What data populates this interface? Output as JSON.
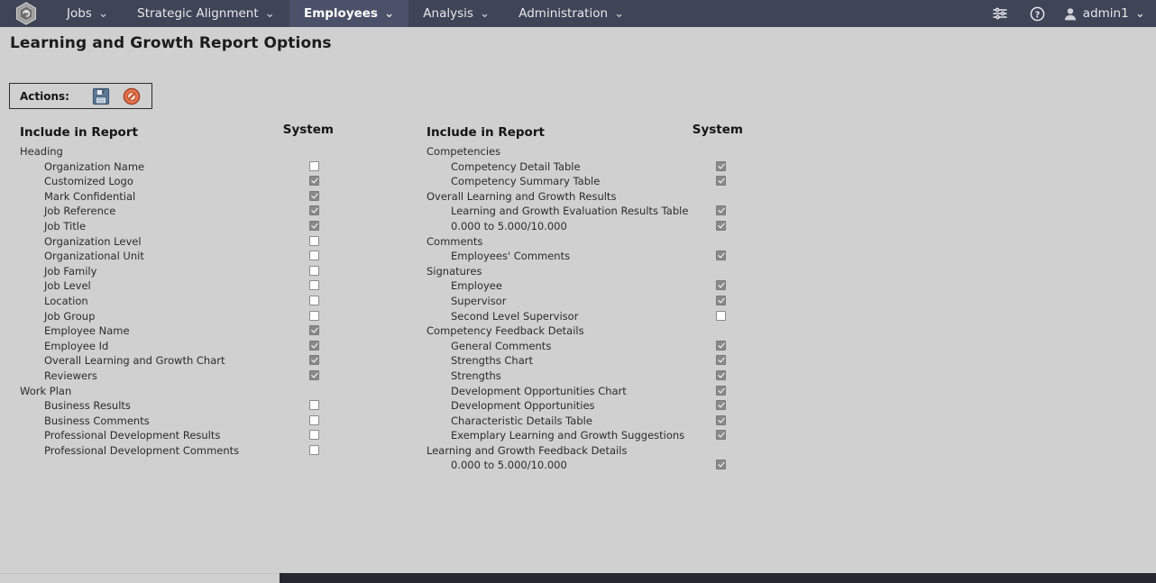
{
  "header": {
    "logo_icon": "hexagon-cube-logo",
    "nav_items": [
      {
        "label": "Jobs",
        "active": false,
        "caret": "⌄"
      },
      {
        "label": "Strategic Alignment",
        "active": false,
        "caret": "⌄"
      },
      {
        "label": "Employees",
        "active": true,
        "caret": "⌄"
      },
      {
        "label": "Analysis",
        "active": false,
        "caret": "⌄"
      },
      {
        "label": "Administration",
        "active": false,
        "caret": "⌄"
      }
    ],
    "right_icons": [
      {
        "name": "sliders-settings-icon"
      },
      {
        "name": "help-question-icon"
      }
    ],
    "user": {
      "name": "admin1",
      "icon": "user-avatar-icon",
      "caret": "⌄"
    },
    "bar_color": "#3f4456",
    "active_tab_color": "#4b5168"
  },
  "page": {
    "title": "Learning and Growth Report Options",
    "background": "#d0d0d0"
  },
  "toolbar": {
    "label": "Actions:",
    "buttons": [
      {
        "name": "save-button",
        "icon": "floppy-disk-save-icon",
        "title": "Save"
      },
      {
        "name": "cancel-button",
        "icon": "prohibited-cancel-icon",
        "title": "Cancel"
      }
    ]
  },
  "columns": [
    {
      "id": "left",
      "header_include": "Include in Report",
      "header_system": "System",
      "rows": [
        {
          "label": "Heading",
          "type": "group"
        },
        {
          "label": "Organization Name",
          "type": "item",
          "checked": false
        },
        {
          "label": "Customized Logo",
          "type": "item",
          "checked": true
        },
        {
          "label": "Mark Confidential",
          "type": "item",
          "checked": true
        },
        {
          "label": "Job Reference",
          "type": "item",
          "checked": true
        },
        {
          "label": "Job Title",
          "type": "item",
          "checked": true
        },
        {
          "label": "Organization Level",
          "type": "item",
          "checked": false
        },
        {
          "label": "Organizational Unit",
          "type": "item",
          "checked": false
        },
        {
          "label": "Job Family",
          "type": "item",
          "checked": false
        },
        {
          "label": "Job Level",
          "type": "item",
          "checked": false
        },
        {
          "label": "Location",
          "type": "item",
          "checked": false
        },
        {
          "label": "Job Group",
          "type": "item",
          "checked": false
        },
        {
          "label": "Employee Name",
          "type": "item",
          "checked": true
        },
        {
          "label": "Employee Id",
          "type": "item",
          "checked": true
        },
        {
          "label": "Overall Learning and Growth Chart",
          "type": "item",
          "checked": true
        },
        {
          "label": "Reviewers",
          "type": "item",
          "checked": true
        },
        {
          "label": "Work Plan",
          "type": "group"
        },
        {
          "label": "Business Results",
          "type": "item",
          "checked": false
        },
        {
          "label": "Business Comments",
          "type": "item",
          "checked": false
        },
        {
          "label": "Professional Development Results",
          "type": "item",
          "checked": false
        },
        {
          "label": "Professional Development Comments",
          "type": "item",
          "checked": false
        }
      ]
    },
    {
      "id": "right",
      "header_include": "Include in Report",
      "header_system": "System",
      "rows": [
        {
          "label": "Competencies",
          "type": "group"
        },
        {
          "label": "Competency Detail Table",
          "type": "item",
          "checked": true
        },
        {
          "label": "Competency Summary Table",
          "type": "item",
          "checked": true
        },
        {
          "label": "Overall Learning and Growth Results",
          "type": "group"
        },
        {
          "label": "Learning and Growth Evaluation Results Table",
          "type": "item",
          "checked": true
        },
        {
          "label": "0.000 to 5.000/10.000",
          "type": "item",
          "checked": true
        },
        {
          "label": "Comments",
          "type": "group"
        },
        {
          "label": "Employees' Comments",
          "type": "item",
          "checked": true
        },
        {
          "label": "Signatures",
          "type": "group"
        },
        {
          "label": "Employee",
          "type": "item",
          "checked": true
        },
        {
          "label": "Supervisor",
          "type": "item",
          "checked": true
        },
        {
          "label": "Second Level Supervisor",
          "type": "item",
          "checked": false
        },
        {
          "label": "Competency Feedback Details",
          "type": "group"
        },
        {
          "label": "General Comments",
          "type": "item",
          "checked": true
        },
        {
          "label": "Strengths Chart",
          "type": "item",
          "checked": true
        },
        {
          "label": "Strengths",
          "type": "item",
          "checked": true
        },
        {
          "label": "Development Opportunities Chart",
          "type": "item",
          "checked": true
        },
        {
          "label": "Development Opportunities",
          "type": "item",
          "checked": true
        },
        {
          "label": "Characteristic Details Table",
          "type": "item",
          "checked": true
        },
        {
          "label": "Exemplary Learning and Growth Suggestions",
          "type": "item",
          "checked": true
        },
        {
          "label": "Learning and Growth Feedback Details",
          "type": "group"
        },
        {
          "label": "0.000 to 5.000/10.000",
          "type": "item",
          "checked": true
        }
      ]
    }
  ],
  "scrollbar": {
    "name": "horizontal-scrollbar",
    "track_color": "#26282f",
    "thumb_color": "#d0d0d0"
  }
}
